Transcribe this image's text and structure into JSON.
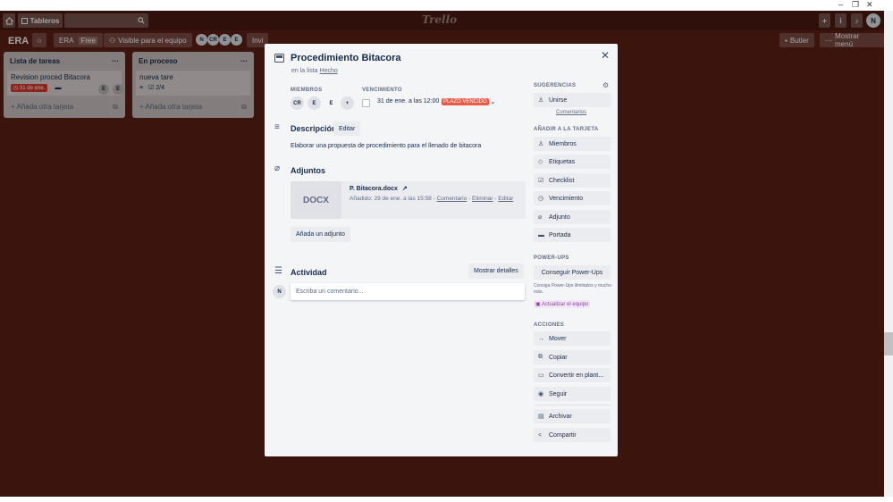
{
  "window": {
    "minimize": "–",
    "restore": "❐",
    "close": "✕"
  },
  "header": {
    "home_icon": "home-icon",
    "boards_label": "Tableros",
    "search_icon": "search-icon",
    "logo": "Trello",
    "user_initial": "N"
  },
  "board": {
    "title": "ERA",
    "team_badge_left": "ERA",
    "team_badge_right": "Free",
    "visibility": "Visible para el equipo",
    "members": [
      "N",
      "CR",
      "E",
      "E"
    ],
    "invite": "Invi",
    "butler": "Butler",
    "show_menu": "Mostrar menú"
  },
  "lists": [
    {
      "title": "Lista de tareas",
      "cards": [
        {
          "title": "Revision proced Bitacora",
          "due": "31 de ene.",
          "members": [
            "E",
            "E"
          ]
        }
      ],
      "add_card": "Añada otra tarjeta"
    },
    {
      "title": "En proceso",
      "cards": [
        {
          "title": "nueva tare",
          "checklist": "2/4"
        }
      ],
      "add_card": "Añada otra tarjeta"
    }
  ],
  "modal": {
    "title": "Procedimiento Bitacora",
    "in_list_prefix": "en la lista",
    "list_name": "Hecho",
    "members_label": "MIEMBROS",
    "members": [
      "CR",
      "E",
      "E"
    ],
    "due_label": "VENCIMIENTO",
    "due_date": "31 de ene. a las 12:00",
    "overdue": "PLAZO VENCIDO",
    "description_heading": "Descripción",
    "edit_label": "Editar",
    "description_text": "Elaborar una propuesta de procedimiento para el llenado de bitacora",
    "attachments_heading": "Adjuntos",
    "attachment": {
      "thumb": "DOCX",
      "name": "P. Bitacora.docx",
      "added": "Añadido: 29 de ene. a las 15:58 -",
      "comment": "Comentario",
      "delete": "Eliminar",
      "edit": "Editar"
    },
    "add_attachment": "Añada un adjunto",
    "activity_heading": "Actividad",
    "show_details": "Mostrar detalles",
    "comment_avatar": "N",
    "comment_placeholder": "Escriba un comentario...",
    "sidebar": {
      "suggestions_label": "SUGERENCIAS",
      "join": "Unirse",
      "comments_link": "Comentarios",
      "add_to_card_label": "AÑADIR A LA TARJETA",
      "add_items": [
        "Miembros",
        "Etiquetas",
        "Checklist",
        "Vencimiento",
        "Adjunto",
        "Portada"
      ],
      "powerups_label": "POWER-UPS",
      "get_powerups": "Conseguir Power-Ups",
      "promo_text": "Consiga Power-Ups ilimitados y mucho más.",
      "upgrade_team": "Actualizar el equipo",
      "actions_label": "ACCIONES",
      "actions": [
        "Mover",
        "Copiar",
        "Convertir en plant...",
        "Seguir",
        "Archivar",
        "Compartir"
      ]
    }
  },
  "colors": {
    "board_bg": "#5a1f14",
    "overdue": "#eb5a46",
    "modal_bg": "#f4f5f7"
  }
}
